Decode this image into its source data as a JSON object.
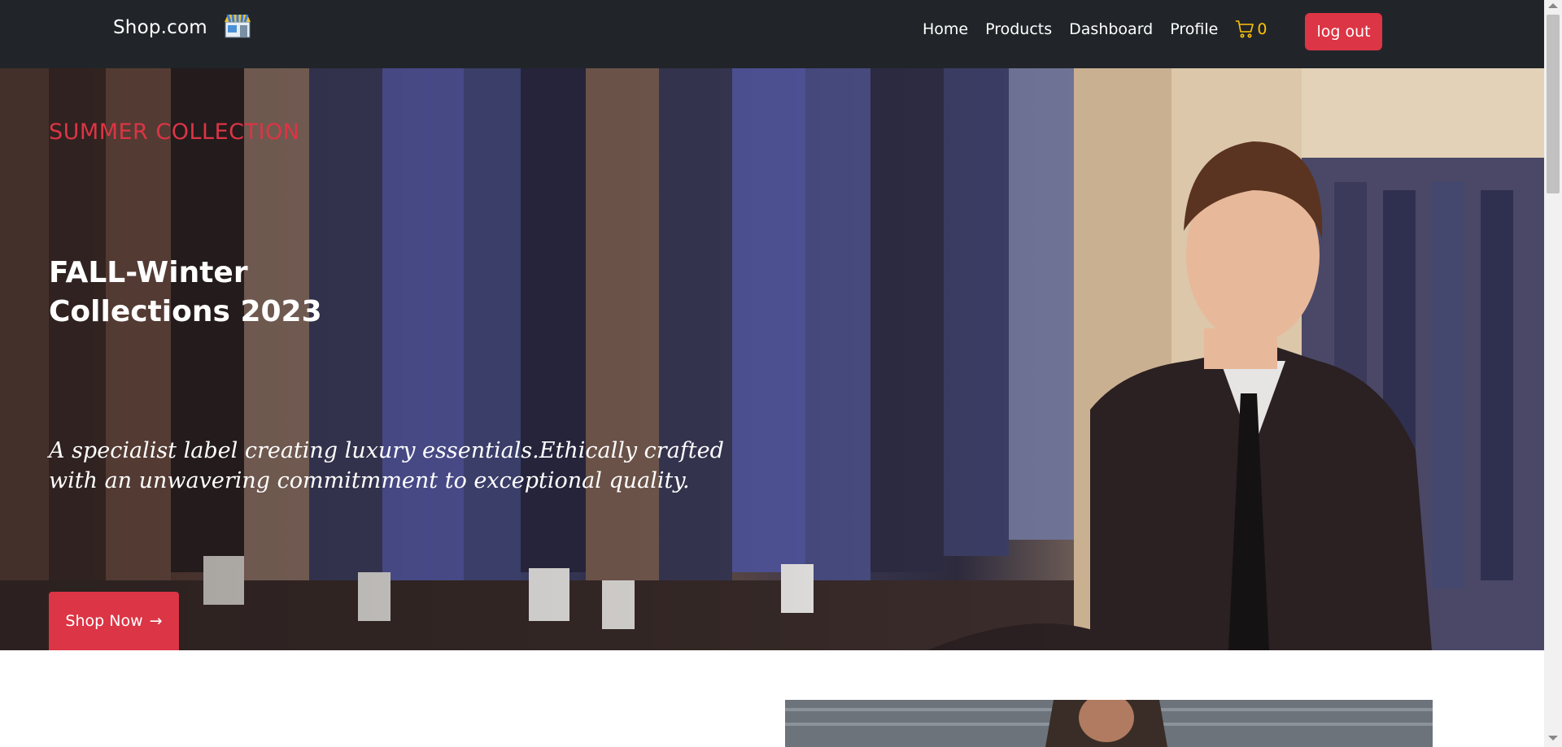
{
  "navbar": {
    "brand": "Shop.com",
    "brand_icon": "store-icon",
    "links": [
      "Home",
      "Products",
      "Dashboard",
      "Profile"
    ],
    "cart_icon": "shopping-cart-icon",
    "cart_count": "0",
    "logout_label": "log out"
  },
  "hero": {
    "eyebrow": "SUMMER COLLECTION",
    "title_line1": "FALL-Winter",
    "title_line2": "Collections 2023",
    "description": "A specialist label creating luxury essentials.Ethically crafted with an unwavering commitmment to exceptional quality.",
    "cta_label": "Shop Now",
    "cta_icon": "arrow-right-icon"
  },
  "colors": {
    "navbar_bg": "#212529",
    "accent_red": "#dc3545",
    "cart_yellow": "#ffc107",
    "text_white": "#ffffff"
  }
}
